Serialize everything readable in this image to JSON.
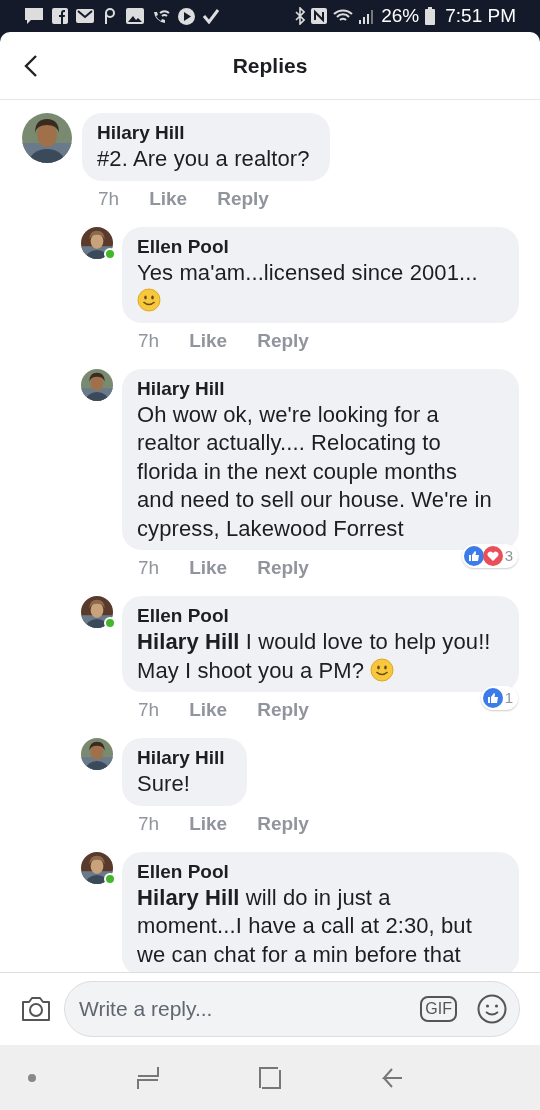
{
  "status_bar": {
    "battery": "26%",
    "time": "7:51 PM"
  },
  "header": {
    "title": "Replies"
  },
  "comments": [
    {
      "author": "Hilary Hill",
      "text": "#2. Are you a realtor?",
      "time": "7h",
      "like": "Like",
      "reply": "Reply",
      "top_level": true,
      "online": false,
      "smiley": false
    },
    {
      "author": "Ellen Pool",
      "text": "Yes ma'am...licensed since 2001...",
      "time": "7h",
      "like": "Like",
      "reply": "Reply",
      "top_level": false,
      "online": true,
      "smiley": true
    },
    {
      "author": "Hilary Hill",
      "text": "Oh wow ok, we're looking for a realtor actually.... Relocating to florida in the next couple months and need to sell our house. We're in cypress, Lakewood Forrest",
      "time": "7h",
      "like": "Like",
      "reply": "Reply",
      "top_level": false,
      "online": false,
      "smiley": false,
      "reactions": {
        "items": [
          {
            "kind": "like"
          },
          {
            "kind": "love"
          }
        ],
        "count": "3"
      }
    },
    {
      "author": "Ellen Pool",
      "text": "**Hilary Hill** I would love to help you!! May I shoot you a PM?",
      "time": "7h",
      "like": "Like",
      "reply": "Reply",
      "top_level": false,
      "online": true,
      "smiley": true,
      "reactions": {
        "items": [
          {
            "kind": "like"
          }
        ],
        "count": "1"
      }
    },
    {
      "author": "Hilary Hill",
      "text": "Sure!",
      "time": "7h",
      "like": "Like",
      "reply": "Reply",
      "top_level": false,
      "online": false,
      "smiley": false
    },
    {
      "author": "Ellen Pool",
      "text": "**Hilary Hill** will do in just a moment...I have a call at 2:30, but we can chat for a min before that",
      "top_level": false,
      "online": true,
      "smiley": false
    }
  ],
  "composer": {
    "placeholder": "Write a reply...",
    "gif": "GIF"
  }
}
